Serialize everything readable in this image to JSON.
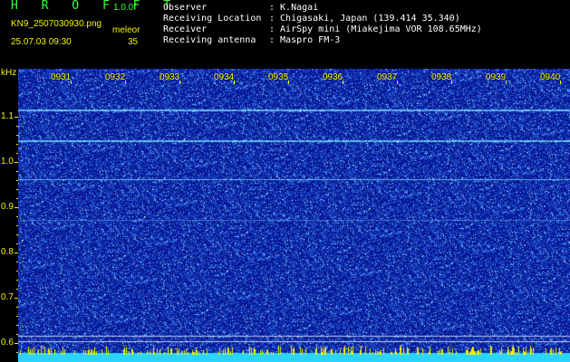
{
  "header": {
    "brand": "H R O F F T",
    "version": "1.0.0f",
    "filename": "KN9_2507030930.png",
    "param_label": "meleor",
    "datetime": "25.07.03 09:30",
    "param_value": "35",
    "info_labels": [
      "Observer",
      "Receiving Location",
      "Receiver",
      "Receiving antenna"
    ],
    "info_values": [
      ": K.Nagai",
      ": Chigasaki, Japan (139.414 35.340)",
      ": AirSpy mini (Miakejima VOR 108.65MHz)",
      ": Maspro FM-3"
    ]
  },
  "spectrogram": {
    "y_unit": "kHz",
    "y_ticks": [
      "1.1",
      "1.0",
      "0.9",
      "0.8",
      "0.7",
      "0.6"
    ],
    "y_range_khz": [
      0.58,
      1.18
    ],
    "time_labels": [
      "0931",
      "0932",
      "0933",
      "0934",
      "0935",
      "0936",
      "0937",
      "0938",
      "0939",
      "0940"
    ],
    "carrier_lines_khz": [
      1.117,
      1.049,
      0.962,
      0.872
    ],
    "bottom_lines_khz": [
      0.616,
      0.604
    ],
    "colors": {
      "background": "#0a1a8c",
      "noise": "#4fa0ff",
      "carrier": "#7fd8ff",
      "axis": "#f2f200",
      "bottom_band": "#2ad4ff"
    }
  }
}
